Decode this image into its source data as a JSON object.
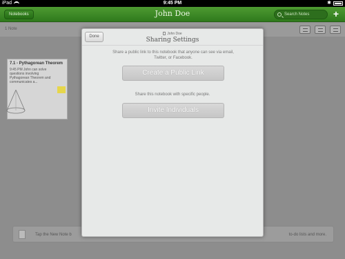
{
  "status_bar": {
    "device": "iPad",
    "time": "9:45 PM"
  },
  "nav": {
    "notebooks_label": "Notebooks",
    "title": "John Doe",
    "search_placeholder": "Search Notes",
    "add_label": "+"
  },
  "toolbar": {
    "notes_count": "1 Note"
  },
  "note": {
    "title": "7.1 - Pythagorean Theorem",
    "snippet": "9:45 PM John can solve questions involving Pythagorean Theorem and communicates a..."
  },
  "hint": {
    "left": "Tap the New Note b",
    "right": "to-do lists and more."
  },
  "modal": {
    "done_label": "Done",
    "notebook_name": "John Doe",
    "title": "Sharing Settings",
    "public_desc": "Share a public link to this notebook that anyone can see via email, Twitter, or Facebook.",
    "public_button": "Create a Public Link",
    "invite_desc": "Share this notebook with specific people.",
    "invite_button": "Invite Individuals"
  }
}
